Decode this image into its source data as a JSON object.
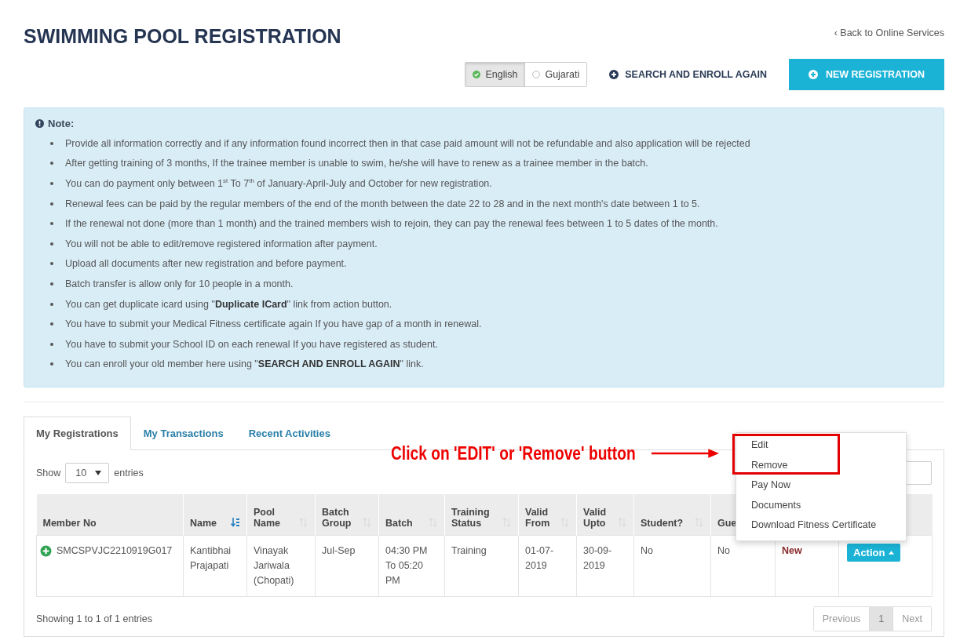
{
  "page": {
    "title": "SWIMMING POOL REGISTRATION",
    "back_link": "‹ Back to Online Services"
  },
  "languages": [
    {
      "label": "English",
      "selected": true
    },
    {
      "label": "Gujarati",
      "selected": false
    }
  ],
  "search_enroll_button": "SEARCH AND ENROLL AGAIN",
  "new_registration_button": "NEW REGISTRATION",
  "note": {
    "title": "Note:",
    "items": [
      "Provide all information correctly and if any information found incorrect then in that case paid amount will not be refundable and also application will be rejected",
      "After getting training of 3 months, If the trainee member is unable to swim, he/she will have to renew as a trainee member in the batch.",
      "You can do payment only between 1$^{st}$ To 7$^{th}$ of January-April-July and October for new registration.",
      "Renewal fees can be paid by the regular members of the end of the month between the date 22 to 28 and in the next month's date between 1 to 5.",
      "If the renewal not done (more than 1 month) and the trained members wish to rejoin, they can pay the renewal fees between 1 to 5 dates of the month.",
      "You will not be able to edit/remove registered information after payment.",
      "Upload all documents after new registration and before payment.",
      "Batch transfer is allow only for 10 people in a month.",
      "You can get duplicate icard using \"**Duplicate ICard**\" link from action button.",
      "You have to submit your Medical Fitness certificate again If you have gap of a month in renewal.",
      "You have to submit your School ID on each renewal If you have registered as student.",
      "You can enroll your old member here using \"**SEARCH AND ENROLL AGAIN**\" link."
    ]
  },
  "tabs": [
    {
      "label": "My Registrations",
      "selected": true
    },
    {
      "label": "My Transactions",
      "selected": false
    },
    {
      "label": "Recent Activities",
      "selected": false
    }
  ],
  "length_menu": {
    "before": "Show",
    "value": "10",
    "after": "entries"
  },
  "table": {
    "columns": [
      {
        "label": "Member No",
        "sortable": false,
        "sorted": false
      },
      {
        "label": "Name",
        "sortable": true,
        "sorted": true
      },
      {
        "label": "Pool Name",
        "sortable": true,
        "sorted": false
      },
      {
        "label": "Batch Group",
        "sortable": true,
        "sorted": false
      },
      {
        "label": "Batch",
        "sortable": true,
        "sorted": false
      },
      {
        "label": "Training Status",
        "sortable": true,
        "sorted": false
      },
      {
        "label": "Valid From",
        "sortable": true,
        "sorted": false
      },
      {
        "label": "Valid Upto",
        "sortable": true,
        "sorted": false
      },
      {
        "label": "Student?",
        "sortable": true,
        "sorted": false
      },
      {
        "label": "Gue"
      }
    ],
    "rows": [
      {
        "cells": [
          "SMCSPVJC2210919G017",
          "Kantibhai Prajapati",
          "Vinayak Jariwala (Chopati)",
          "Jul-Sep",
          "04:30 PM To 05:20 PM",
          "Training",
          "01-07-2019",
          "30-09-2019",
          "No",
          "No"
        ],
        "status": "New",
        "action": "Action"
      }
    ]
  },
  "info": "Showing 1 to 1 of 1 entries",
  "pagination": [
    {
      "label": "Previous",
      "selected": false
    },
    {
      "label": "1",
      "selected": true
    },
    {
      "label": "Next",
      "selected": false
    }
  ],
  "action_menu": [
    "Edit",
    "Remove",
    "Pay Now",
    "Documents",
    "Download Fitness Certificate"
  ],
  "annotation": "Click on 'EDIT' or 'Remove' button"
}
